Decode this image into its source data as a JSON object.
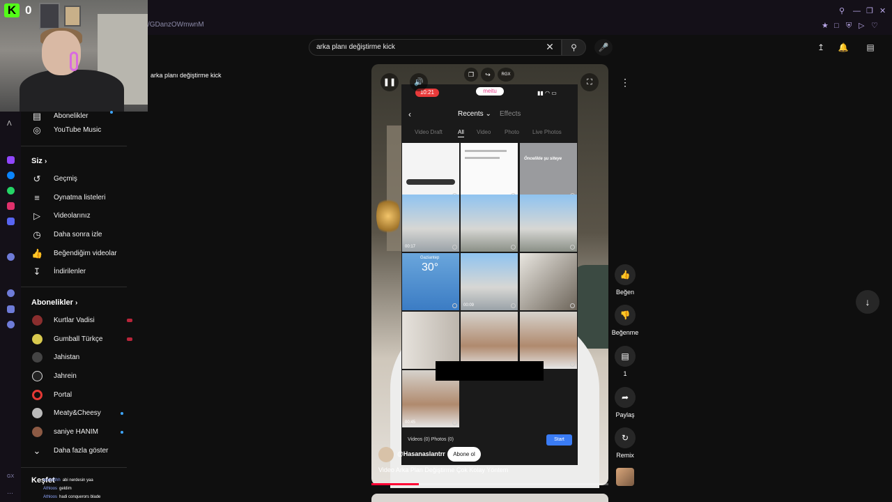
{
  "browser": {
    "url_fragment": "/GDanzOWmwnM"
  },
  "stream": {
    "platform_badge": "K",
    "viewer_count": "0"
  },
  "header": {
    "search_value": "arka planı değiştirme kick",
    "search_icon": "search-icon",
    "clear_icon": "close-icon",
    "mic_icon": "mic-icon",
    "right_icons": [
      "upload-icon",
      "bell-icon",
      "cast-icon"
    ]
  },
  "previous_video_title": "arka planı değiştirme kick",
  "sidebar": {
    "top_items": [
      {
        "label": "Abonelikler",
        "icon": "subscriptions-icon"
      },
      {
        "label": "YouTube Music",
        "icon": "music-icon"
      }
    ],
    "siz_header": "Siz",
    "siz_items": [
      {
        "label": "Geçmiş",
        "icon": "history-icon"
      },
      {
        "label": "Oynatma listeleri",
        "icon": "playlist-icon"
      },
      {
        "label": "Videolarınız",
        "icon": "video-icon"
      },
      {
        "label": "Daha sonra izle",
        "icon": "clock-icon"
      },
      {
        "label": "Beğendiğim videolar",
        "icon": "thumbs-up-icon"
      },
      {
        "label": "İndirilenler",
        "icon": "download-icon"
      }
    ],
    "subs_header": "Abonelikler",
    "subscriptions": [
      {
        "label": "Kurtlar Vadisi",
        "avatar_color": "#8a2e2e",
        "status": "live"
      },
      {
        "label": "Gumball Türkçe",
        "avatar_color": "#d8c94e",
        "status": "live"
      },
      {
        "label": "Jahistan",
        "avatar_color": "#444444",
        "status": "none"
      },
      {
        "label": "Jahrein",
        "avatar_color": "#222222",
        "status": "none"
      },
      {
        "label": "Portal",
        "avatar_color": "#e53935",
        "status": "none"
      },
      {
        "label": "Meaty&Cheesy",
        "avatar_color": "#bbbbbb",
        "status": "new"
      },
      {
        "label": "saniye HANIM",
        "avatar_color": "#8c5a44",
        "status": "new"
      }
    ],
    "show_more": "Daha fazla göster",
    "explore_header": "Keşfet"
  },
  "chat": [
    {
      "user": "wolfoShh",
      "text": "abi nerdesin yaa"
    },
    {
      "user": "Athloos",
      "text": "geldim"
    },
    {
      "user": "Athloos",
      "text": "hadi conquerors blade"
    }
  ],
  "short": {
    "phone": {
      "time": "10:21",
      "app_name": "meitu",
      "album": "Recents",
      "effects_tab": "Effects",
      "filter_tabs": [
        "Video Draft",
        "All",
        "Video",
        "Photo",
        "Live Photos"
      ],
      "active_tab": "All",
      "tile_labels": {
        "note": "Öncelikle şu siteye",
        "weather_city": "Gaziantep",
        "weather_temp": "30°",
        "dur1": "00:17",
        "dur2": "00:09",
        "dur3": "00:45"
      },
      "selection_count": "Videos (0) Photos (0)",
      "start_label": "Start"
    },
    "channel": "@Hasanaslantrr",
    "subscribe_label": "Abone ol",
    "title": "Video Arka Plan Değiştirme Çok Kolay Yöntem",
    "progress": 0.2
  },
  "actions": [
    {
      "label": "Beğen",
      "icon": "thumbs-up-icon"
    },
    {
      "label": "Beğenme",
      "icon": "thumbs-down-icon"
    },
    {
      "label": "1",
      "icon": "comment-icon"
    },
    {
      "label": "Paylaş",
      "icon": "share-icon"
    },
    {
      "label": "Remix",
      "icon": "remix-icon"
    }
  ]
}
